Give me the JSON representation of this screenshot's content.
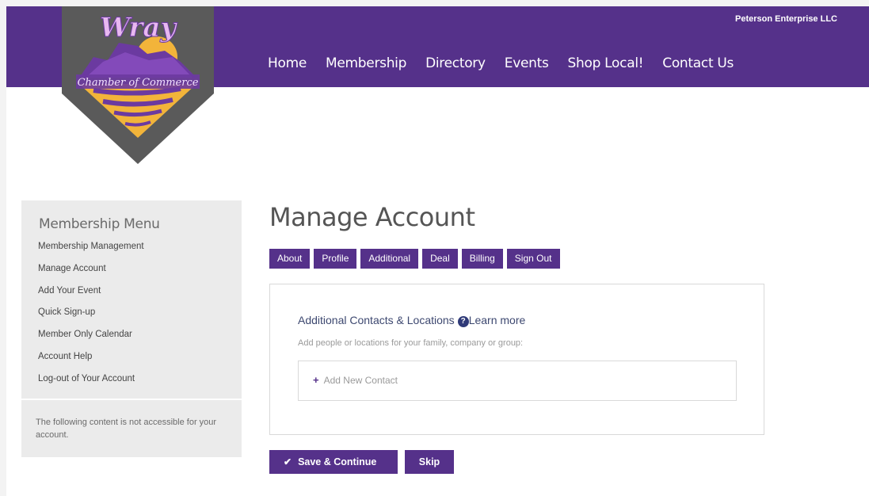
{
  "header": {
    "account_name": "Peterson Enterprise LLC",
    "nav": [
      "Home",
      "Membership",
      "Directory",
      "Events",
      "Shop Local!",
      "Contact Us"
    ]
  },
  "logo": {
    "line1": "Wray",
    "line2": "Chamber of Commerce"
  },
  "sidebar": {
    "title": "Membership Menu",
    "links": [
      "Membership Management",
      "Manage Account",
      "Add Your Event",
      "Quick Sign-up",
      "Member Only Calendar",
      "Account Help",
      "Log-out of Your Account"
    ],
    "notice": "The following content is not accessible for your account."
  },
  "main": {
    "title": "Manage Account",
    "tabs": [
      "About",
      "Profile",
      "Additional",
      "Deal",
      "Billing",
      "Sign Out"
    ],
    "section_title": "Additional Contacts & Locations",
    "help_glyph": "?",
    "learn_more": "Learn more",
    "section_desc": "Add people or locations for your family, company or group:",
    "add_contact_label": "Add New Contact",
    "save_label": "Save & Continue",
    "skip_label": "Skip"
  },
  "colors": {
    "brand_purple": "#55318a",
    "panel_border": "#d9d9d9",
    "sidebar_bg": "#ebebeb"
  }
}
